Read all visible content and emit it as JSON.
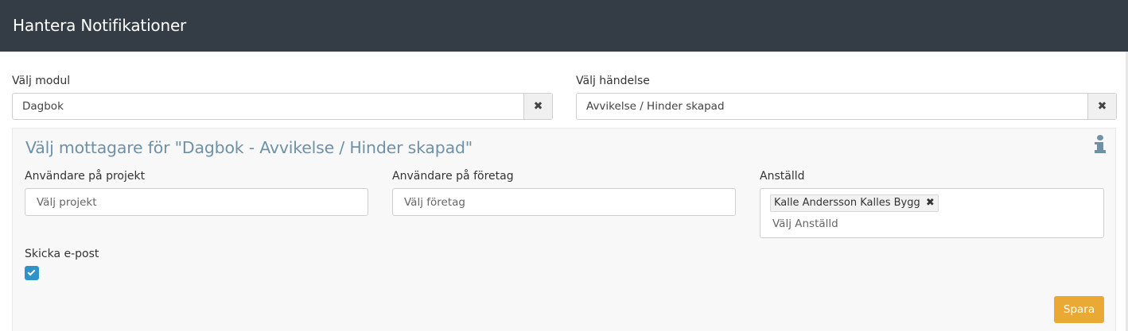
{
  "header": {
    "title": "Hantera Notifikationer"
  },
  "module": {
    "label": "Välj modul",
    "value": "Dagbok",
    "clear_icon": "✖"
  },
  "event": {
    "label": "Välj händelse",
    "value": "Avvikelse / Hinder skapad",
    "clear_icon": "✖"
  },
  "recipients": {
    "title": "Välj mottagare för \"Dagbok - Avvikelse / Hinder skapad\"",
    "info_icon": "info-icon",
    "project_users": {
      "label": "Användare på projekt",
      "placeholder": "Välj projekt"
    },
    "company_users": {
      "label": "Användare på företag",
      "placeholder": "Välj företag"
    },
    "employee": {
      "label": "Anställd",
      "selected": [
        "Kalle Andersson Kalles Bygg"
      ],
      "remove_icon": "✖",
      "placeholder": "Välj Anställd"
    },
    "send_email": {
      "label": "Skicka e-post",
      "checked": true
    },
    "save_label": "Spara"
  },
  "colors": {
    "header_bg": "#343d46",
    "accent_blue": "#2f93c8",
    "title_blue": "#6f91a6",
    "save_orange": "#eaa935"
  }
}
